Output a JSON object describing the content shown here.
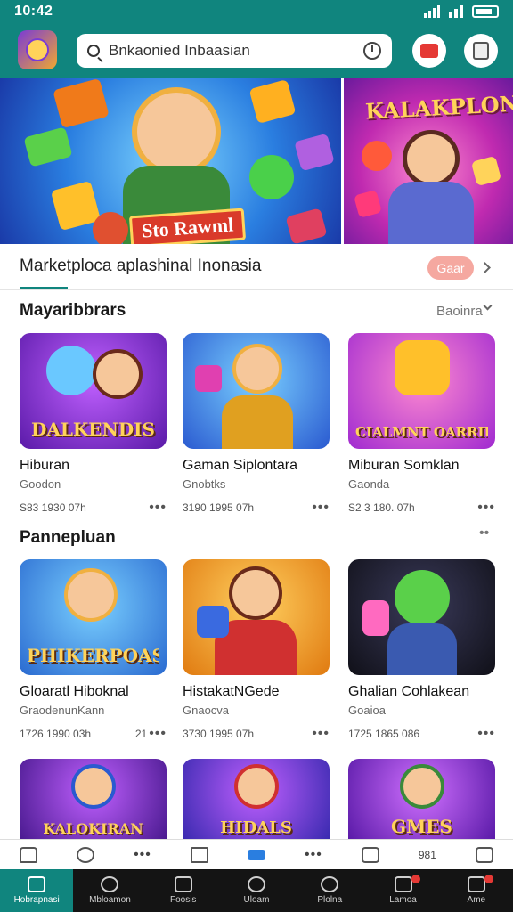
{
  "status": {
    "time": "10:42"
  },
  "search": {
    "value": "Bnkaonied Inbaasian",
    "placeholder": "Bnkaonied Inbaasian"
  },
  "banner": {
    "left_tag": "Sto Rawml",
    "right_title": "KALAKPLON"
  },
  "market": {
    "title": "Marketploca aplashinal Inonasia",
    "pill": "Gaar"
  },
  "sections": [
    {
      "title": "Mayaribbrars",
      "more": "Baoinra",
      "cards": [
        {
          "thumb_text": "DALKENDIS",
          "name": "Hiburan",
          "sub": "Goodon",
          "meta": "S83 1930 07h"
        },
        {
          "thumb_text": "",
          "name": "Gaman Siplontara",
          "sub": "Gnobtks",
          "meta": "3190 1995 07h"
        },
        {
          "thumb_text": "CIALMNT OARRIES",
          "name": "Miburan Somklan",
          "sub": "Gaonda",
          "meta": "S2 3 180. 07h"
        }
      ]
    },
    {
      "title": "Pannepluan",
      "more": "",
      "cards": [
        {
          "thumb_text": "PHIKERPOAS",
          "name": "Gloaratl Hiboknal",
          "sub": "GraodenunKann",
          "meta": "1726 1990 03h",
          "extra": "21"
        },
        {
          "thumb_text": "",
          "name": "HistakatNGede",
          "sub": "Gnaocva",
          "meta": "3730 1995 07h"
        },
        {
          "thumb_text": "",
          "name": "Ghalian Cohlakean",
          "sub": "Goaioa",
          "meta": "1725 1865 086"
        }
      ]
    },
    {
      "cards": [
        {
          "thumb_text": "KALOKIRAN"
        },
        {
          "thumb_text": "HIDALS"
        },
        {
          "thumb_text": "GMES"
        }
      ]
    }
  ],
  "subnav": {
    "label": "981"
  },
  "bottom_nav": [
    {
      "label": "Hobrapnasi",
      "icon": "home-icon"
    },
    {
      "label": "Mbloamon",
      "icon": "search-icon"
    },
    {
      "label": "Foosis",
      "icon": "news-icon"
    },
    {
      "label": "Uloam",
      "icon": "circle-icon"
    },
    {
      "label": "Plolna",
      "icon": "user-icon"
    },
    {
      "label": "Lamoa",
      "icon": "wallet-icon"
    },
    {
      "label": "Ame",
      "icon": "upload-icon"
    }
  ],
  "colors": {
    "accent": "#10857e",
    "pill": "#f5a8a0",
    "badge": "#e53935"
  }
}
